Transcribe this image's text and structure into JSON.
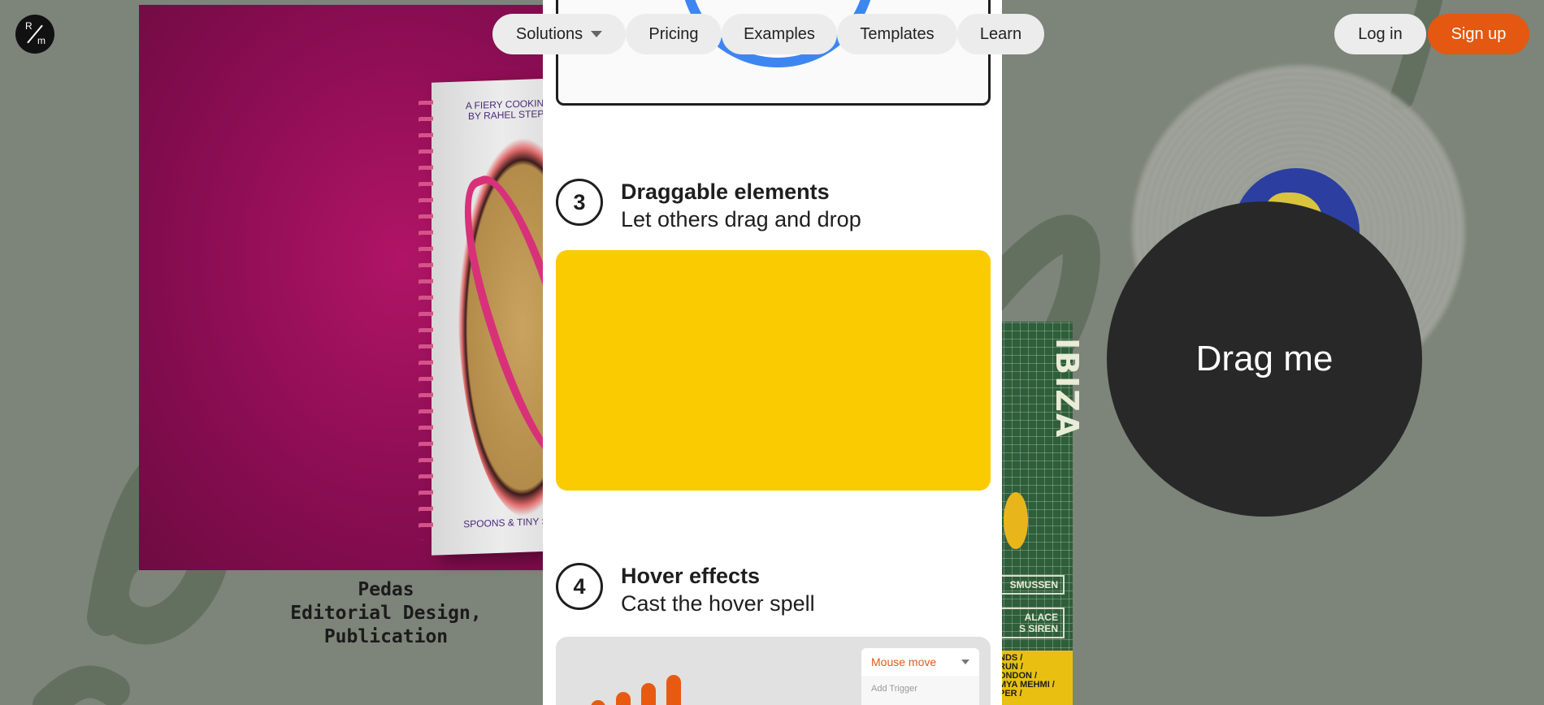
{
  "brand": {
    "logo_top": "R",
    "logo_bottom": "m"
  },
  "nav": {
    "solutions": "Solutions",
    "pricing": "Pricing",
    "examples": "Examples",
    "templates": "Templates",
    "learn": "Learn",
    "login": "Log in",
    "signup": "Sign up"
  },
  "background": {
    "book": {
      "title_line1": "A FIERY COOKING ZINE",
      "title_line2": "BY RAHEL STEPHANIE",
      "footer": "SPOONS & TINY STUDIO"
    },
    "project": {
      "name": "Pedas",
      "category": "Editorial Design, Publication"
    },
    "poster": {
      "big_text": "IBIZA",
      "box1": "SMUSSEN",
      "box2_line1": "ALACE",
      "box2_line2": "S SIREN",
      "yellow_lines": [
        "NDS /",
        "RUN /",
        "ONDON /",
        "MYA MEHMI /",
        "PER /"
      ]
    }
  },
  "panel": {
    "step3": {
      "number": "3",
      "title": "Draggable elements",
      "subtitle": "Let others drag and drop"
    },
    "step4": {
      "number": "4",
      "title": "Hover effects",
      "subtitle": "Cast the hover spell"
    },
    "hover_demo": {
      "trigger_label": "Mouse move",
      "add_trigger": "Add Trigger",
      "bar_levels": [
        0.3,
        0.45,
        0.6,
        0.75,
        0.9
      ]
    }
  },
  "drag": {
    "label": "Drag me"
  },
  "colors": {
    "accent": "#e45811",
    "yellow": "#facb00",
    "blue_ring": "#3d86f2",
    "dark_circle": "#282828"
  }
}
